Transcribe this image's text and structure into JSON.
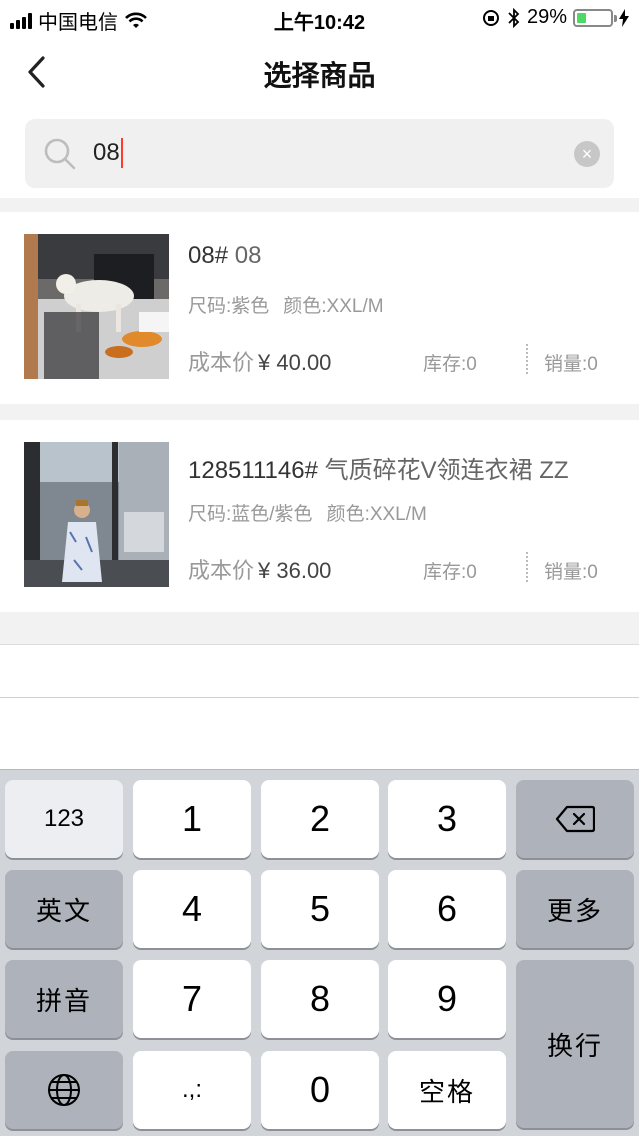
{
  "status_bar": {
    "carrier": "中国电信",
    "time": "上午10:42",
    "battery_percent": "29%",
    "battery_level": 0.29
  },
  "nav": {
    "title": "选择商品"
  },
  "search": {
    "value": "08"
  },
  "products": [
    {
      "name": "08#",
      "code": "08",
      "spec_size": "尺码:紫色",
      "spec_color": "颜色:XXL/M",
      "price_label": "成本价",
      "price_value": "¥ 40.00",
      "stock": "库存:0",
      "sales": "销量:0"
    },
    {
      "name": "128511146#",
      "code": "气质碎花V领连衣裙 ZZ",
      "spec_size": "尺码:蓝色/紫色",
      "spec_color": "颜色:XXL/M",
      "price_label": "成本价",
      "price_value": "¥ 36.00",
      "stock": "库存:0",
      "sales": "销量:0"
    }
  ],
  "keyboard": {
    "k_123": "123",
    "k_1": "1",
    "k_2": "2",
    "k_3": "3",
    "k_english": "英文",
    "k_4": "4",
    "k_5": "5",
    "k_6": "6",
    "k_more": "更多",
    "k_pinyin": "拼音",
    "k_7": "7",
    "k_8": "8",
    "k_9": "9",
    "k_return": "换行",
    "k_punct": ".,:",
    "k_0": "0",
    "k_space": "空格"
  }
}
